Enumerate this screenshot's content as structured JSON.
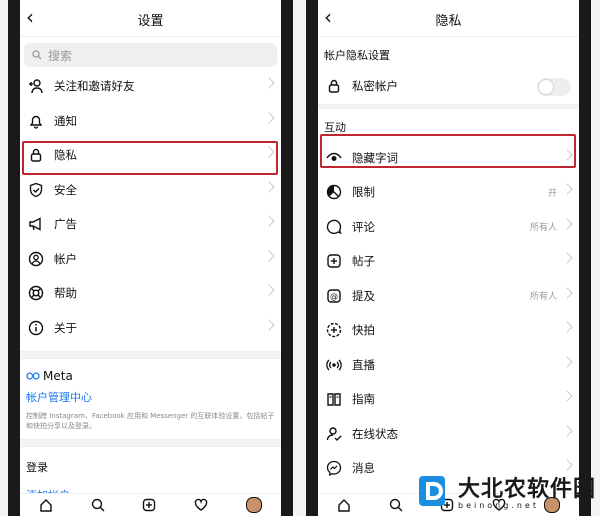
{
  "left": {
    "title": "设置",
    "search_placeholder": "搜索",
    "items": [
      {
        "label": "关注和邀请好友",
        "icon": "add-person-icon"
      },
      {
        "label": "通知",
        "icon": "bell-icon"
      },
      {
        "label": "隐私",
        "icon": "lock-icon"
      },
      {
        "label": "安全",
        "icon": "shield-icon"
      },
      {
        "label": "广告",
        "icon": "megaphone-icon"
      },
      {
        "label": "帐户",
        "icon": "account-icon"
      },
      {
        "label": "帮助",
        "icon": "lifebuoy-icon"
      },
      {
        "label": "关于",
        "icon": "info-icon"
      }
    ],
    "meta_logo": "Meta",
    "meta_link": "帐户管理中心",
    "meta_desc": "控制跨 Instagram、Facebook 应用和 Messenger 的互联体验设置，包括帖子和快拍分享以及登录。",
    "login_section": "登录",
    "add_account": "添加帐户"
  },
  "right": {
    "title": "隐私",
    "account_privacy_header": "帐户隐私设置",
    "private_account_label": "私密帐户",
    "private_account_on": false,
    "interaction_header": "互动",
    "items": [
      {
        "label": "隐藏字词",
        "icon": "eye-icon",
        "value": ""
      },
      {
        "label": "限制",
        "icon": "restrict-icon",
        "value": "开"
      },
      {
        "label": "评论",
        "icon": "comment-icon",
        "value": "所有人"
      },
      {
        "label": "帖子",
        "icon": "plus-square-icon",
        "value": ""
      },
      {
        "label": "提及",
        "icon": "at-icon",
        "value": "所有人"
      },
      {
        "label": "快拍",
        "icon": "story-icon",
        "value": ""
      },
      {
        "label": "直播",
        "icon": "live-icon",
        "value": ""
      },
      {
        "label": "指南",
        "icon": "guide-icon",
        "value": ""
      },
      {
        "label": "在线状态",
        "icon": "activity-status-icon",
        "value": ""
      },
      {
        "label": "消息",
        "icon": "messenger-icon",
        "value": ""
      }
    ]
  },
  "watermark": {
    "name": "大北农软件园",
    "sub": "beinong.net"
  },
  "colors": {
    "highlight": "#c0262e",
    "link": "#1877f2"
  }
}
